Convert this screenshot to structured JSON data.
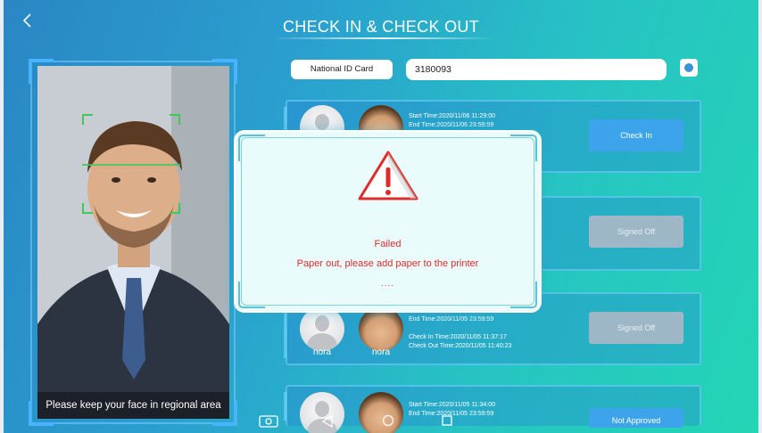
{
  "header": {
    "title": "CHECK IN & CHECK OUT"
  },
  "camera": {
    "hint": "Please keep your face in regional area"
  },
  "search": {
    "id_type": "National ID Card",
    "id_value": "3180093"
  },
  "records": [
    {
      "start_time": "Start Time:2020/11/06 11:29:00",
      "end_time": "End Time:2020/11/06 23:59:59",
      "action": "Check In"
    },
    {
      "action": "Signed Off"
    },
    {
      "name_left": "nora",
      "name_right": "nora",
      "end_time": "End Time:2020/11/05 23:59:59",
      "check_in_time": "Check In Time:2020/11/05 11:37:17",
      "check_out_time": "Check Out Time:2020/11/05 11:40:23",
      "action": "Signed Off"
    },
    {
      "start_time": "Start Time:2020/11/05 11:34:00",
      "end_time": "End Time:2020/11/05 23:59:59",
      "action": "Not Approved"
    }
  ],
  "modal": {
    "status": "Failed",
    "message": "Paper out, please add paper to the printer",
    "dots": "....",
    "icon": "warning-triangle-icon"
  },
  "colors": {
    "primary_button": "#3da4ec",
    "disabled_button": "#9eb7c7",
    "error_text": "#e02b2b",
    "face_frame": "#43c75b"
  }
}
